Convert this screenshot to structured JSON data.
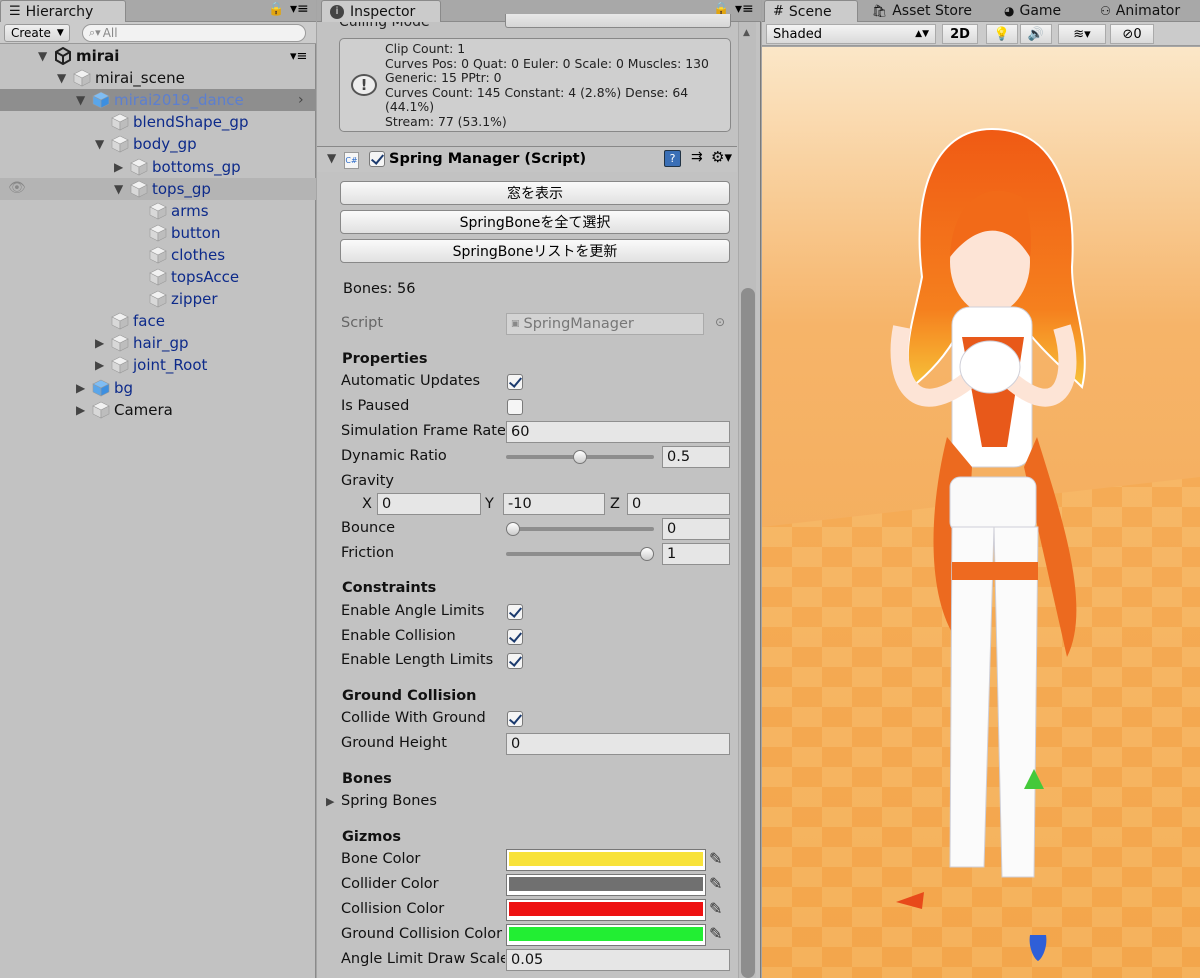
{
  "hierarchy": {
    "tab_label": "Hierarchy",
    "create_label": "Create",
    "search_placeholder": "All",
    "rows": [
      {
        "label": "mirai",
        "depth": 0,
        "arrow": "down",
        "icon": "unity-logo"
      },
      {
        "label": "mirai_scene",
        "depth": 1,
        "arrow": "down",
        "icon": "cube-icon"
      },
      {
        "label": "mirai2019_dance",
        "depth": 2,
        "arrow": "down",
        "icon": "prefab-cube-icon",
        "selected": true
      },
      {
        "label": "blendShape_gp",
        "depth": 3,
        "arrow": "none",
        "icon": "cube-icon"
      },
      {
        "label": "body_gp",
        "depth": 3,
        "arrow": "down",
        "icon": "cube-icon"
      },
      {
        "label": "bottoms_gp",
        "depth": 4,
        "arrow": "right",
        "icon": "cube-icon"
      },
      {
        "label": "tops_gp",
        "depth": 4,
        "arrow": "down",
        "icon": "cube-icon",
        "hover": true
      },
      {
        "label": "arms",
        "depth": 5,
        "arrow": "none",
        "icon": "cube-icon"
      },
      {
        "label": "button",
        "depth": 5,
        "arrow": "none",
        "icon": "cube-icon"
      },
      {
        "label": "clothes",
        "depth": 5,
        "arrow": "none",
        "icon": "cube-icon"
      },
      {
        "label": "topsAcce",
        "depth": 5,
        "arrow": "none",
        "icon": "cube-icon"
      },
      {
        "label": "zipper",
        "depth": 5,
        "arrow": "none",
        "icon": "cube-icon"
      },
      {
        "label": "face",
        "depth": 3,
        "arrow": "none",
        "icon": "cube-icon"
      },
      {
        "label": "hair_gp",
        "depth": 3,
        "arrow": "right",
        "icon": "cube-icon"
      },
      {
        "label": "joint_Root",
        "depth": 3,
        "arrow": "right",
        "icon": "cube-icon"
      },
      {
        "label": "bg",
        "depth": 2,
        "arrow": "right",
        "icon": "prefab-cube-icon"
      },
      {
        "label": "Camera",
        "depth": 2,
        "arrow": "right",
        "icon": "cube-icon",
        "black": true
      }
    ]
  },
  "inspector": {
    "tab_label": "Inspector",
    "culling_label": "Culling Mode",
    "info_lines": [
      "Clip Count: 1",
      "Curves Pos: 0 Quat: 0 Euler: 0 Scale: 0 Muscles: 130",
      "Generic: 15 PPtr: 0",
      "Curves Count: 145 Constant: 4 (2.8%) Dense: 64 (44.1%)",
      "Stream: 77 (53.1%)"
    ],
    "component_title": "Spring Manager (Script)",
    "buttons": [
      "窓を表示",
      "SpringBoneを全て選択",
      "SpringBoneリストを更新"
    ],
    "bones_count": "Bones: 56",
    "script_label": "Script",
    "script_value": "SpringManager",
    "properties_header": "Properties",
    "automatic_updates_label": "Automatic Updates",
    "automatic_updates": true,
    "is_paused_label": "Is Paused",
    "is_paused": false,
    "sim_rate_label": "Simulation Frame Rate",
    "sim_rate": "60",
    "dynamic_ratio_label": "Dynamic Ratio",
    "dynamic_ratio": "0.5",
    "dynamic_ratio_fraction": 0.5,
    "gravity_label": "Gravity",
    "gravity": {
      "x_label": "X",
      "x": "0",
      "y_label": "Y",
      "y": "-10",
      "z_label": "Z",
      "z": "0"
    },
    "bounce_label": "Bounce",
    "bounce": "0",
    "bounce_fraction": 0,
    "friction_label": "Friction",
    "friction": "1",
    "friction_fraction": 1,
    "constraints_header": "Constraints",
    "angle_limits_label": "Enable Angle Limits",
    "angle_limits": true,
    "collision_label": "Enable Collision",
    "collision": true,
    "length_limits_label": "Enable Length Limits",
    "length_limits": true,
    "ground_header": "Ground Collision",
    "collide_ground_label": "Collide With Ground",
    "collide_ground": true,
    "ground_height_label": "Ground Height",
    "ground_height": "0",
    "bones_header": "Bones",
    "spring_bones_label": "Spring Bones",
    "gizmos_header": "Gizmos",
    "bone_color_label": "Bone Color",
    "bone_color": "#f8e23a",
    "collider_color_label": "Collider Color",
    "collider_color": "#707070",
    "collision_color_label": "Collision Color",
    "collision_color": "#ee1111",
    "ground_color_label": "Ground Collision Color",
    "ground_color": "#22ee33",
    "angle_draw_label": "Angle Limit Draw Scale",
    "angle_draw": "0.05"
  },
  "scene": {
    "tabs": [
      "Scene",
      "Asset Store",
      "Game",
      "Animator"
    ],
    "shading": "Shaded",
    "mode_2d": "2D",
    "hidden_count": "0"
  }
}
